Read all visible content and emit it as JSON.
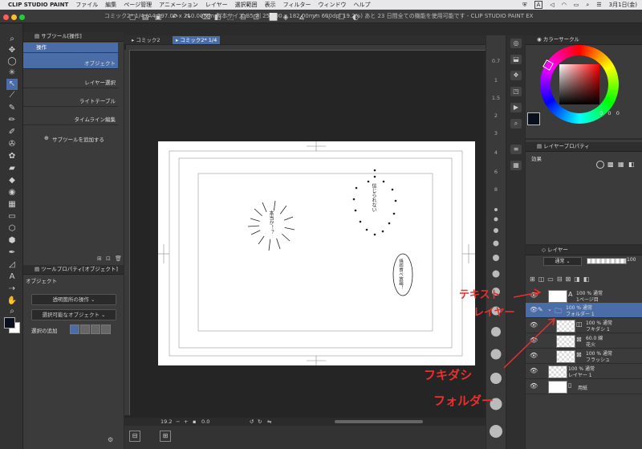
{
  "menubar": {
    "app": "CLIP STUDIO PAINT",
    "items": [
      "ファイル",
      "編集",
      "ページ管理",
      "アニメーション",
      "レイヤー",
      "選択範囲",
      "表示",
      "フィルター",
      "ウィンドウ",
      "ヘルプ"
    ],
    "right": {
      "letter": "A",
      "date": "3月1日(金)"
    }
  },
  "titlebar": {
    "text": "コミック2* 1/4 (A4 297.00 x 210.00mm 製本サイズ:B5 判 257.00 x 182.00mm 600dpi 19.2%)  あと 23 日間全ての機能を使用可能です - CLIP STUDIO PAINT EX"
  },
  "subtool": {
    "header": "サブツール[操作]",
    "group": "操作",
    "items": [
      "オブジェクト",
      "レイヤー選択",
      "ライトテーブル",
      "タイムライン編集"
    ],
    "add": "サブツールを追加する"
  },
  "toolprop": {
    "header": "ツールプロパティ[オブジェクト]",
    "label": "オブジェクト",
    "dropdown1": "透明箇所の操作",
    "dropdown2": "選択可能なオブジェクト",
    "add_select": "選択の追加"
  },
  "tabs": {
    "tab1": "コミック2",
    "tab2": "コミック2* 1/4"
  },
  "canvas": {
    "balloon1": "本当か！？",
    "balloon2": "信じられない",
    "balloon3": "焼肉食べ放題！"
  },
  "nav_numbers": [
    "0.7",
    "1",
    "1.5",
    "2",
    "3",
    "4",
    "6",
    "8"
  ],
  "bottombar": {
    "zoom": "19.2",
    "angle": "0.0"
  },
  "color": {
    "header": "カラーサークル",
    "values": [
      "0",
      "0",
      "0"
    ]
  },
  "layerprop": {
    "header": "レイヤープロパティ",
    "effect": "効果"
  },
  "layers": {
    "header": "レイヤー",
    "blend": "通常",
    "opacity": "100",
    "rows": [
      {
        "pct": "100 % 通常",
        "name": "1ページ目"
      },
      {
        "pct": "100 % 通常",
        "name": "フォルダー 1"
      },
      {
        "pct": "100 % 通常",
        "name": "フキダシ 1"
      },
      {
        "pct": "60.0 線",
        "name": "花火"
      },
      {
        "pct": "100 % 通常",
        "name": "フラッシュ"
      },
      {
        "pct": "100 % 通常",
        "name": "レイヤー 1"
      },
      {
        "pct": "",
        "name": "用紙"
      }
    ]
  },
  "annotations": {
    "text_layer_1": "テキスト",
    "text_layer_2": "レイヤー",
    "balloon_folder_1": "フキダシ",
    "balloon_folder_2": "フォルダー"
  },
  "colors": {
    "accent": "#4a6da7",
    "annotation": "#e83030"
  }
}
